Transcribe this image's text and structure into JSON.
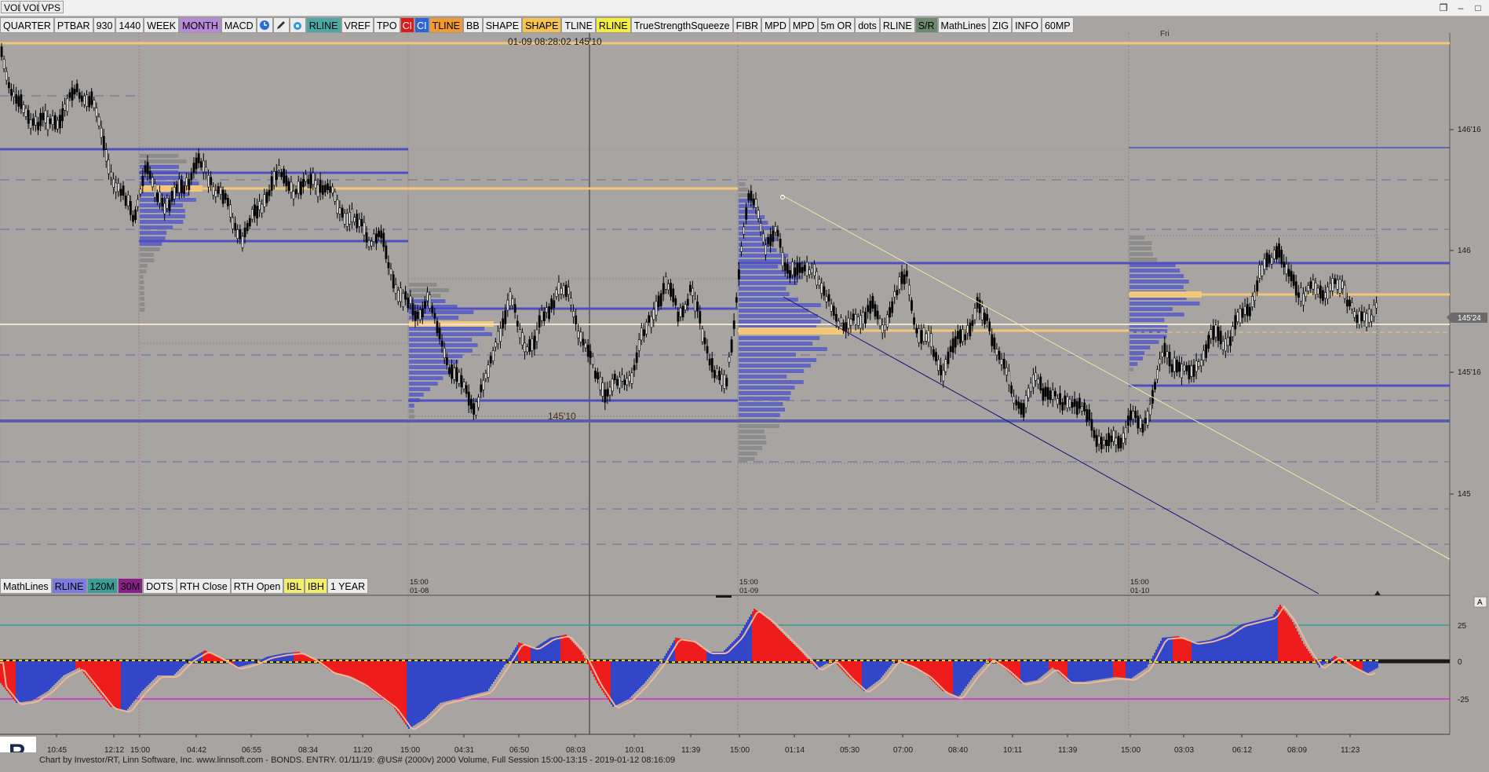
{
  "top_buttons": [
    "VOL",
    "VOL",
    "VPS"
  ],
  "window_controls": [
    "restore-icon",
    "minimize-icon",
    "maximize-icon"
  ],
  "toolbar": [
    {
      "label": "QUARTER",
      "bg": "#ececec",
      "fg": "#000000"
    },
    {
      "label": "PTBAR",
      "bg": "#ececec",
      "fg": "#000000"
    },
    {
      "label": "930",
      "bg": "#ececec",
      "fg": "#000000"
    },
    {
      "label": "1440",
      "bg": "#ececec",
      "fg": "#000000"
    },
    {
      "label": "WEEK",
      "bg": "#ececec",
      "fg": "#000000"
    },
    {
      "label": "MONTH",
      "bg": "#b889d9",
      "fg": "#000000"
    },
    {
      "label": "MACD",
      "bg": "#ececec",
      "fg": "#000000"
    },
    {
      "icon": "clock-icon"
    },
    {
      "icon": "pencil-icon"
    },
    {
      "icon": "drop-icon"
    },
    {
      "label": "RLINE",
      "bg": "#4aa9a5",
      "fg": "#000000"
    },
    {
      "label": "VREF",
      "bg": "#ececec",
      "fg": "#000000"
    },
    {
      "label": "TPO",
      "bg": "#ececec",
      "fg": "#000000"
    },
    {
      "label": "CI",
      "bg": "#e01818",
      "fg": "#ffffff",
      "tiny": true
    },
    {
      "label": "CI",
      "bg": "#2d63d8",
      "fg": "#ffffff",
      "tiny": true
    },
    {
      "label": "TLINE",
      "bg": "#f29a2e",
      "fg": "#000000"
    },
    {
      "label": "BB",
      "bg": "#ececec",
      "fg": "#000000"
    },
    {
      "label": "SHAPE",
      "bg": "#ececec",
      "fg": "#000000"
    },
    {
      "label": "SHAPE",
      "bg": "#f6c44f",
      "fg": "#000000"
    },
    {
      "label": "TLINE",
      "bg": "#ececec",
      "fg": "#000000"
    },
    {
      "label": "RLINE",
      "bg": "#f5ee3a",
      "fg": "#000000"
    },
    {
      "label": "TrueStrengthSqueeze",
      "bg": "#ececec",
      "fg": "#000000"
    },
    {
      "label": "FIBR",
      "bg": "#ececec",
      "fg": "#000000"
    },
    {
      "label": "MPD",
      "bg": "#ececec",
      "fg": "#000000"
    },
    {
      "label": "MPD",
      "bg": "#ececec",
      "fg": "#000000"
    },
    {
      "label": "5m OR",
      "bg": "#ececec",
      "fg": "#000000"
    },
    {
      "label": "dots",
      "bg": "#ececec",
      "fg": "#000000"
    },
    {
      "label": "RLINE",
      "bg": "#ececec",
      "fg": "#000000"
    },
    {
      "label": "S/R",
      "bg": "#6b8a6e",
      "fg": "#000000"
    },
    {
      "label": "MathLines",
      "bg": "#ececec",
      "fg": "#000000"
    },
    {
      "label": "ZIG",
      "bg": "#ececec",
      "fg": "#000000"
    },
    {
      "label": "INFO",
      "bg": "#ececec",
      "fg": "#000000"
    },
    {
      "label": "60MP",
      "bg": "#ececec",
      "fg": "#000000"
    }
  ],
  "toolbar2": [
    {
      "label": "MathLines",
      "bg": "#ececec",
      "fg": "#000000"
    },
    {
      "label": "RLINE",
      "bg": "#7b7be0",
      "fg": "#000000"
    },
    {
      "label": "120M",
      "bg": "#3a9e9a",
      "fg": "#000000"
    },
    {
      "label": "30M",
      "bg": "#8a1f8a",
      "fg": "#000000"
    },
    {
      "label": "DOTS",
      "bg": "#ececec",
      "fg": "#000000"
    },
    {
      "label": "RTH Close",
      "bg": "#ececec",
      "fg": "#000000"
    },
    {
      "label": "RTH Open",
      "bg": "#ececec",
      "fg": "#000000"
    },
    {
      "label": "IBL",
      "bg": "#f4ee6a",
      "fg": "#000000"
    },
    {
      "label": "IBH",
      "bg": "#f4ee6a",
      "fg": "#000000"
    },
    {
      "label": "1 YEAR",
      "bg": "#ececec",
      "fg": "#000000"
    }
  ],
  "crosshair_label": "01-09 08:28:02  145'10",
  "crosshair_price_low": "145'10",
  "day_label": "Fri",
  "price_axis": [
    "146'16",
    "146",
    "145'16",
    "145"
  ],
  "current_price": "145'24",
  "session_labels": [
    {
      "time": "15:00",
      "date": "01-08"
    },
    {
      "time": "15:00",
      "date": "01-09"
    },
    {
      "time": "15:00",
      "date": "01-10"
    }
  ],
  "osc_axis": [
    "25",
    "0",
    "-25"
  ],
  "osc_panel_label": "A",
  "time_axis": [
    "10:45",
    "12:12",
    "15:00",
    "04:42",
    "06:55",
    "08:34",
    "11:20",
    "15:00",
    "04:31",
    "06:50",
    "08:03",
    "10:01",
    "11:39",
    "15:00",
    "01:14",
    "05:30",
    "07:00",
    "08:40",
    "10:11",
    "11:39",
    "15:00",
    "03:03",
    "06:12",
    "08:09",
    "11:23"
  ],
  "status_text": "Chart by Investor/RT, Linn Software, Inc. www.linnsoft.com - BONDS. ENTRY.     01/11/19: @US# (2000v) 2000 Volume, Full Session 15:00-13:15 - 2019-01-12 08:16:09",
  "logo_letter": "R",
  "colors": {
    "background": "#a7a4a2",
    "candle": "#000000",
    "profile_blue": "#5a5fc6",
    "profile_gray": "#8a8a8a",
    "line_orange": "#f3c779",
    "line_blue": "#4f4fc0",
    "osc_blue": "#3346c8",
    "osc_red": "#ee1c1c",
    "osc_signal": "#f0b69a",
    "teal_level": "#2f9e95",
    "magenta_level": "#d62ad4"
  }
}
